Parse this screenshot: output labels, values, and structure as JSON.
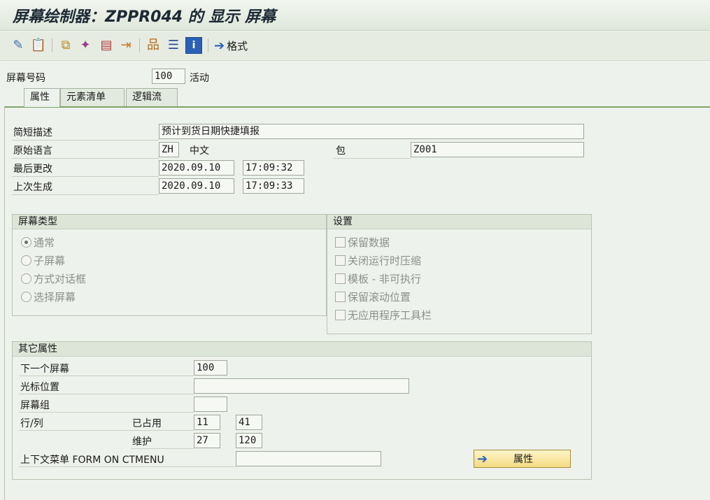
{
  "window": {
    "title": "屏幕绘制器：ZPPR044 的 显示 屏幕"
  },
  "toolbar": {
    "icons": [
      "glasses-pencil-icon",
      "paste-icon",
      "hierarchy-icon",
      "magic-wand-icon",
      "layout-icon",
      "export-icon",
      "tree-icon",
      "text-align-icon",
      "info-icon"
    ],
    "format_label": "格式"
  },
  "screen": {
    "label": "屏幕号码",
    "value": "100",
    "status": "活动"
  },
  "tabs": [
    {
      "label": "属性",
      "active": true
    },
    {
      "label": "元素清单",
      "active": false
    },
    {
      "label": "逻辑流",
      "active": false
    }
  ],
  "attributes": {
    "short_desc_label": "简短描述",
    "short_desc_value": "预计到货日期快捷填报",
    "orig_lang_label": "原始语言",
    "orig_lang_code": "ZH",
    "orig_lang_name": "中文",
    "package_label": "包",
    "package_value": "Z001",
    "last_changed_label": "最后更改",
    "last_changed_date": "2020.09.10",
    "last_changed_time": "17:09:32",
    "last_generated_label": "上次生成",
    "last_generated_date": "2020.09.10",
    "last_generated_time": "17:09:33"
  },
  "screen_type": {
    "header": "屏幕类型",
    "options": [
      "通常",
      "子屏幕",
      "方式对话框",
      "选择屏幕"
    ],
    "selected_index": 0
  },
  "settings": {
    "header": "设置",
    "options": [
      "保留数据",
      "关闭运行时压缩",
      "模板 - 非可执行",
      "保留滚动位置",
      "无应用程序工具栏"
    ]
  },
  "other": {
    "header": "其它属性",
    "next_screen_label": "下一个屏幕",
    "next_screen_value": "100",
    "cursor_label": "光标位置",
    "cursor_value": "",
    "screen_group_label": "屏幕组",
    "screen_group_value": "",
    "rowcol_label": "行/列",
    "used_label": "已占用",
    "used_row": "11",
    "used_col": "41",
    "maint_label": "维护",
    "maint_row": "27",
    "maint_col": "120",
    "ctx_menu_label": "上下文菜单 FORM ON CTMENU",
    "ctx_menu_value": "",
    "attr_button_label": "属性"
  }
}
